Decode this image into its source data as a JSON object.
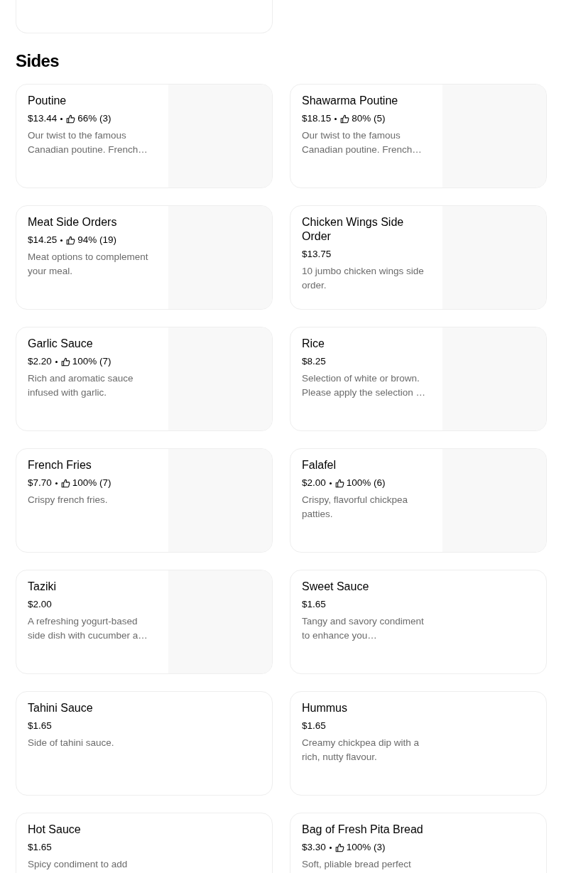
{
  "section": {
    "title": "Sides"
  },
  "items": [
    {
      "name": "Poutine",
      "price": "$13.44",
      "rating": "66% (3)",
      "description": "Our twist to the famous Canadian poutine. French…",
      "has_image": true
    },
    {
      "name": "Shawarma Poutine",
      "price": "$18.15",
      "rating": "80% (5)",
      "description": "Our twist to the famous Canadian poutine. French…",
      "has_image": true
    },
    {
      "name": "Meat Side Orders",
      "price": "$14.25",
      "rating": "94% (19)",
      "description": "Meat options to complement your meal.",
      "has_image": true
    },
    {
      "name": "Chicken Wings Side Order",
      "price": "$13.75",
      "description": "10 jumbo chicken wings side order.",
      "has_image": true
    },
    {
      "name": "Garlic Sauce",
      "price": "$2.20",
      "rating": "100% (7)",
      "description": "Rich and aromatic sauce infused with garlic.",
      "has_image": true
    },
    {
      "name": "Rice",
      "price": "$8.25",
      "description": "Selection of white or brown. Please apply the selection …",
      "has_image": true
    },
    {
      "name": "French Fries",
      "price": "$7.70",
      "rating": "100% (7)",
      "description": "Crispy french fries.",
      "has_image": true
    },
    {
      "name": "Falafel",
      "price": "$2.00",
      "rating": "100% (6)",
      "description": "Crispy, flavorful chickpea patties.",
      "has_image": true
    },
    {
      "name": "Taziki",
      "price": "$2.00",
      "description": "A refreshing yogurt-based side dish with cucumber a…",
      "has_image": true
    },
    {
      "name": "Sweet Sauce",
      "price": "$1.65",
      "description": "Tangy and savory condiment to enhance you…",
      "has_image": false
    },
    {
      "name": "Tahini Sauce",
      "price": "$1.65",
      "description": "Side of tahini sauce.",
      "has_image": false
    },
    {
      "name": "Hummus",
      "price": "$1.65",
      "description": "Creamy chickpea dip with a rich, nutty flavour.",
      "has_image": false
    },
    {
      "name": "Hot Sauce",
      "price": "$1.65",
      "description": "Spicy condiment to add",
      "has_image": false
    },
    {
      "name": "Bag of Fresh Pita Bread",
      "price": "$3.30",
      "rating": "100% (3)",
      "description": "Soft, pliable bread perfect",
      "has_image": false
    }
  ]
}
